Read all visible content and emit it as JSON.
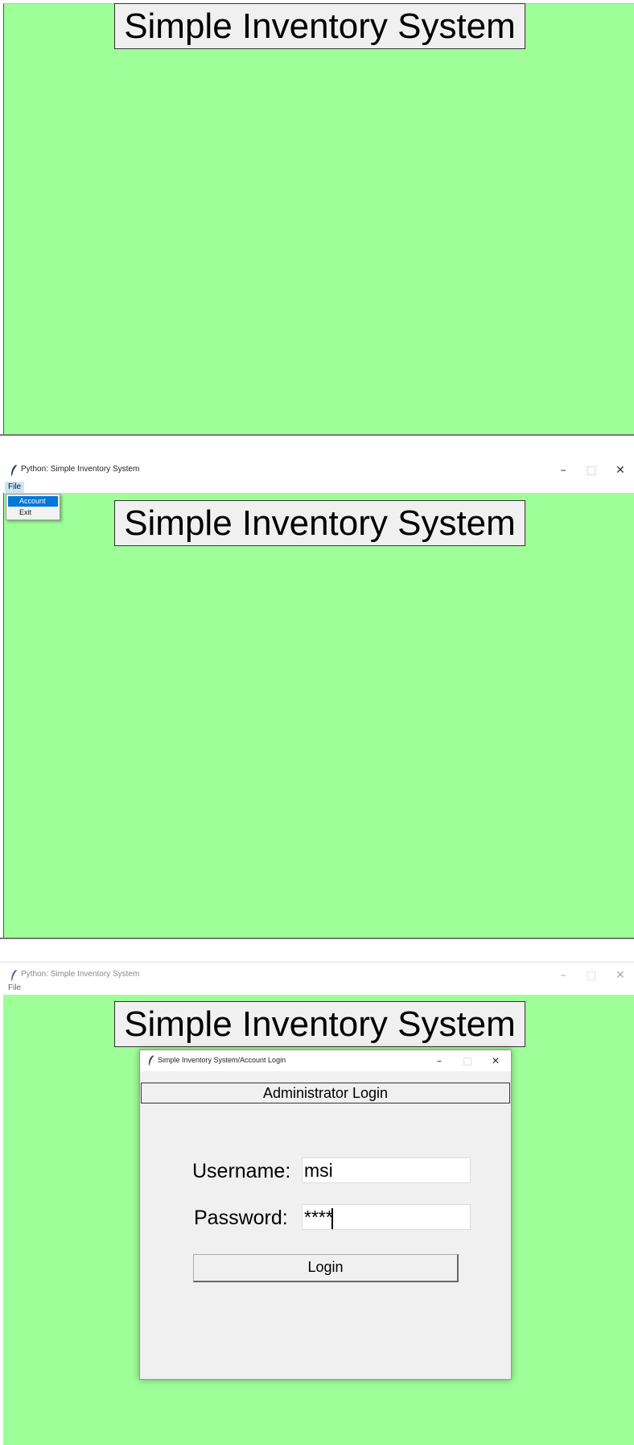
{
  "app": {
    "window_title": "Python: Simple Inventory System",
    "banner_text": "Simple Inventory System",
    "background_color": "#9eff98"
  },
  "window_controls": {
    "minimize": "–",
    "maximize": "□",
    "close": "✕"
  },
  "menu": {
    "file_label": "File",
    "dropdown_items": [
      "Account",
      "Exit"
    ],
    "selected_item": "Account"
  },
  "login_dialog": {
    "title": "Simple Inventory System/Account Login",
    "header": "Administrator Login",
    "username_label": "Username:",
    "username_value": "msi",
    "password_label": "Password:",
    "password_value": "****",
    "login_button": "Login"
  }
}
